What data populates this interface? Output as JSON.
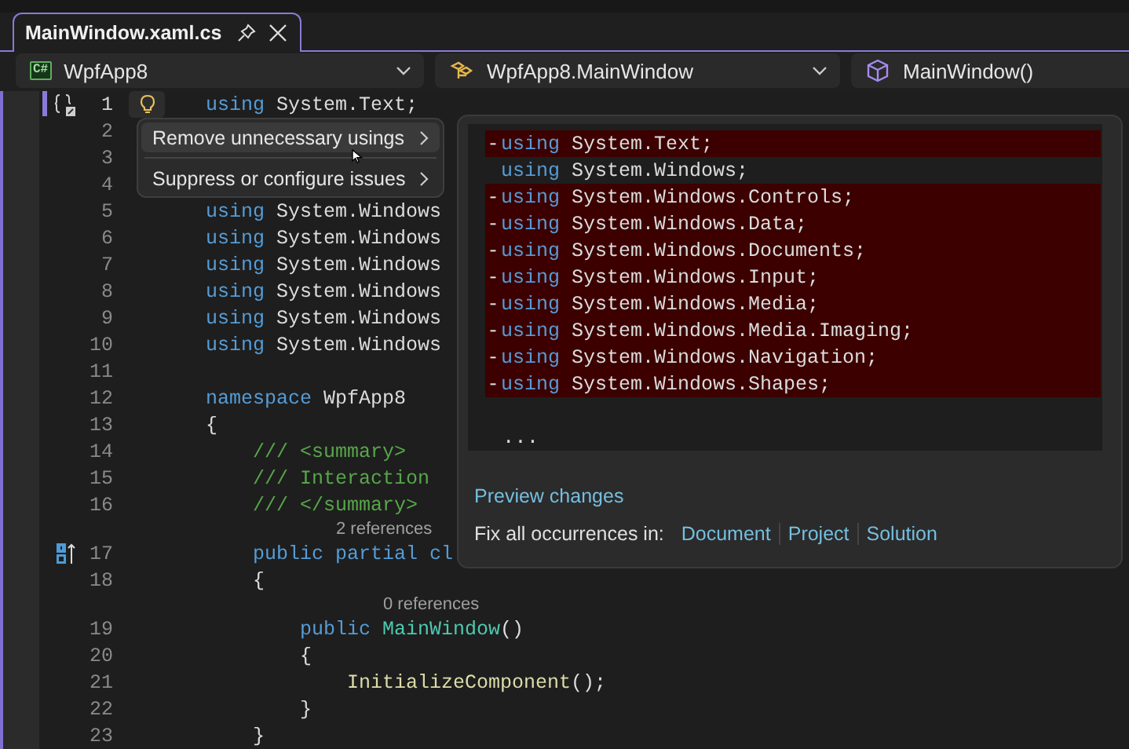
{
  "tabs": [
    {
      "label": "MainWindow.xaml.cs",
      "selected": true
    }
  ],
  "navigation": [
    {
      "kind": "project",
      "badge": "C#",
      "label": "WpfApp8",
      "expandable": true
    },
    {
      "kind": "class",
      "label": "WpfApp8.MainWindow",
      "expandable": true
    },
    {
      "kind": "member",
      "label": "MainWindow()",
      "expandable": false
    }
  ],
  "editor": {
    "lines": [
      {
        "number": "1",
        "current": true,
        "gutter": {
          "kind": "collapse"
        },
        "lightbulb": true,
        "tokens": [
          {
            "kind": "keyword",
            "text": "using"
          },
          {
            "kind": "plain",
            "text": " System.Text;"
          }
        ]
      },
      {
        "number": "2",
        "current": false
      },
      {
        "number": "3",
        "current": false
      },
      {
        "number": "4",
        "current": false
      },
      {
        "number": "5",
        "current": false,
        "tokens": [
          {
            "kind": "keyword",
            "text": "using"
          },
          {
            "kind": "plain",
            "text": " System.Windows"
          }
        ]
      },
      {
        "number": "6",
        "current": false,
        "tokens": [
          {
            "kind": "keyword",
            "text": "using"
          },
          {
            "kind": "plain",
            "text": " System.Windows"
          }
        ]
      },
      {
        "number": "7",
        "current": false,
        "tokens": [
          {
            "kind": "keyword",
            "text": "using"
          },
          {
            "kind": "plain",
            "text": " System.Windows"
          }
        ]
      },
      {
        "number": "8",
        "current": false,
        "tokens": [
          {
            "kind": "keyword",
            "text": "using"
          },
          {
            "kind": "plain",
            "text": " System.Windows"
          }
        ]
      },
      {
        "number": "9",
        "current": false,
        "tokens": [
          {
            "kind": "keyword",
            "text": "using"
          },
          {
            "kind": "plain",
            "text": " System.Windows"
          }
        ]
      },
      {
        "number": "10",
        "current": false,
        "tokens": [
          {
            "kind": "keyword",
            "text": "using"
          },
          {
            "kind": "plain",
            "text": " System.Windows"
          }
        ]
      },
      {
        "number": "11",
        "current": false
      },
      {
        "number": "12",
        "current": false,
        "tokens": [
          {
            "kind": "keyword",
            "text": "namespace"
          },
          {
            "kind": "plain",
            "text": " WpfApp8"
          }
        ]
      },
      {
        "number": "13",
        "current": false,
        "tokens": [
          {
            "kind": "plain",
            "text": "{"
          }
        ]
      },
      {
        "number": "14",
        "current": false,
        "tokens": [
          {
            "kind": "comment",
            "text": "    /// <summary>"
          }
        ]
      },
      {
        "number": "15",
        "current": false,
        "tokens": [
          {
            "kind": "comment",
            "text": "    /// Interaction"
          }
        ]
      },
      {
        "number": "16",
        "current": false,
        "tokens": [
          {
            "kind": "comment",
            "text": "    /// </summary>"
          }
        ]
      },
      {
        "number": "17",
        "current": false,
        "gutter": {
          "kind": "implements"
        },
        "codelens": "2 references",
        "tokens": [
          {
            "kind": "keyword",
            "text": "    public partial cl"
          }
        ]
      },
      {
        "number": "18",
        "current": false,
        "tokens": [
          {
            "kind": "plain",
            "text": "    {"
          }
        ]
      },
      {
        "number": "19",
        "current": false,
        "codelens": "0 references",
        "tokens": [
          {
            "kind": "keyword",
            "text": "        public "
          },
          {
            "kind": "type",
            "text": "MainWindow"
          },
          {
            "kind": "plain",
            "text": "()"
          }
        ]
      },
      {
        "number": "20",
        "current": false,
        "tokens": [
          {
            "kind": "plain",
            "text": "        {"
          }
        ]
      },
      {
        "number": "21",
        "current": false,
        "tokens": [
          {
            "kind": "method",
            "text": "            InitializeComponent"
          },
          {
            "kind": "plain",
            "text": "();"
          }
        ]
      },
      {
        "number": "22",
        "current": false,
        "tokens": [
          {
            "kind": "plain",
            "text": "        }"
          }
        ]
      },
      {
        "number": "23",
        "current": false,
        "tokens": [
          {
            "kind": "plain",
            "text": "    }"
          }
        ]
      }
    ]
  },
  "quick_actions_menu": {
    "items": [
      {
        "label": "Remove unnecessary usings",
        "selected": true
      },
      {
        "label": "Suppress or configure issues",
        "selected": false
      }
    ]
  },
  "preview": {
    "diff": [
      {
        "removed": true,
        "sign": "-",
        "tokens": [
          {
            "kind": "keyword",
            "text": "using"
          },
          {
            "kind": "plain",
            "text": " System.Text;"
          }
        ]
      },
      {
        "removed": false,
        "tokens": [
          {
            "kind": "keyword",
            "text": "using"
          },
          {
            "kind": "plain",
            "text": " System.Windows;"
          }
        ]
      },
      {
        "removed": true,
        "sign": "-",
        "tokens": [
          {
            "kind": "keyword",
            "text": "using"
          },
          {
            "kind": "plain",
            "text": " System.Windows.Controls;"
          }
        ]
      },
      {
        "removed": true,
        "sign": "-",
        "tokens": [
          {
            "kind": "keyword",
            "text": "using"
          },
          {
            "kind": "plain",
            "text": " System.Windows.Data;"
          }
        ]
      },
      {
        "removed": true,
        "sign": "-",
        "tokens": [
          {
            "kind": "keyword",
            "text": "using"
          },
          {
            "kind": "plain",
            "text": " System.Windows.Documents;"
          }
        ]
      },
      {
        "removed": true,
        "sign": "-",
        "tokens": [
          {
            "kind": "keyword",
            "text": "using"
          },
          {
            "kind": "plain",
            "text": " System.Windows.Input;"
          }
        ]
      },
      {
        "removed": true,
        "sign": "-",
        "tokens": [
          {
            "kind": "keyword",
            "text": "using"
          },
          {
            "kind": "plain",
            "text": " System.Windows.Media;"
          }
        ]
      },
      {
        "removed": true,
        "sign": "-",
        "tokens": [
          {
            "kind": "keyword",
            "text": "using"
          },
          {
            "kind": "plain",
            "text": " System.Windows.Media.Imaging;"
          }
        ]
      },
      {
        "removed": true,
        "sign": "-",
        "tokens": [
          {
            "kind": "keyword",
            "text": "using"
          },
          {
            "kind": "plain",
            "text": " System.Windows.Navigation;"
          }
        ]
      },
      {
        "removed": true,
        "sign": "-",
        "tokens": [
          {
            "kind": "keyword",
            "text": "using"
          },
          {
            "kind": "plain",
            "text": " System.Windows.Shapes;"
          }
        ]
      }
    ],
    "ellipsis": "...",
    "preview_link": "Preview changes",
    "fix_all_label": "Fix all occurrences in:",
    "scopes": [
      "Document",
      "Project",
      "Solution"
    ]
  }
}
